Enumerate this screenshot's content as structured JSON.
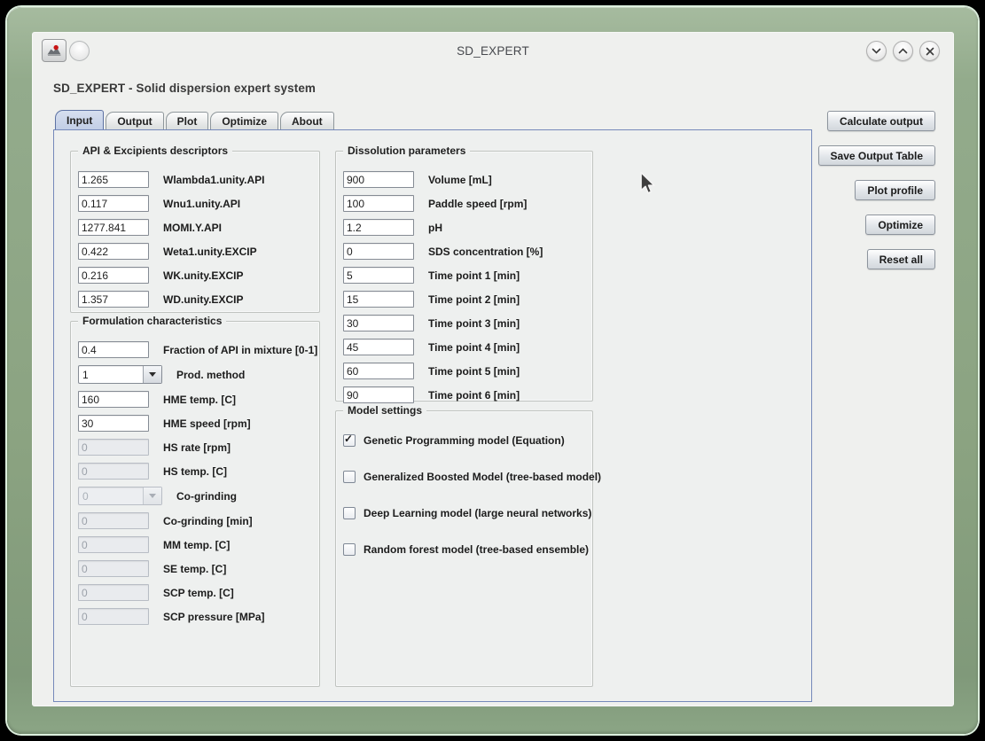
{
  "titlebar": {
    "title": "SD_EXPERT",
    "controls": [
      {
        "name": "minimize",
        "icon": "chevron-down-icon"
      },
      {
        "name": "maximize",
        "icon": "chevron-up-icon"
      },
      {
        "name": "close",
        "icon": "close-icon"
      }
    ]
  },
  "heading": "SD_EXPERT - Solid dispersion expert system",
  "tabs": [
    {
      "label": "Input",
      "selected": true
    },
    {
      "label": "Output",
      "selected": false
    },
    {
      "label": "Plot",
      "selected": false
    },
    {
      "label": "Optimize",
      "selected": false
    },
    {
      "label": "About",
      "selected": false
    }
  ],
  "groups": {
    "api": {
      "title": "API & Excipients descriptors",
      "rows": [
        {
          "value": "1.265",
          "label": "Wlambda1.unity.API",
          "type": "text",
          "enabled": true
        },
        {
          "value": "0.117",
          "label": "Wnu1.unity.API",
          "type": "text",
          "enabled": true
        },
        {
          "value": "1277.841",
          "label": "MOMI.Y.API",
          "type": "text",
          "enabled": true
        },
        {
          "value": "0.422",
          "label": "Weta1.unity.EXCIP",
          "type": "text",
          "enabled": true
        },
        {
          "value": "0.216",
          "label": "WK.unity.EXCIP",
          "type": "text",
          "enabled": true
        },
        {
          "value": "1.357",
          "label": "WD.unity.EXCIP",
          "type": "text",
          "enabled": true
        }
      ]
    },
    "formulation": {
      "title": "Formulation characteristics",
      "rows": [
        {
          "value": "0.4",
          "label": "Fraction of API in mixture [0-1]",
          "type": "text",
          "enabled": true
        },
        {
          "value": "1",
          "label": "Prod. method",
          "type": "combo",
          "enabled": true
        },
        {
          "value": "160",
          "label": "HME temp. [C]",
          "type": "text",
          "enabled": true
        },
        {
          "value": "30",
          "label": "HME speed [rpm]",
          "type": "text",
          "enabled": true
        },
        {
          "value": "0",
          "label": "HS rate [rpm]",
          "type": "text",
          "enabled": false
        },
        {
          "value": "0",
          "label": "HS temp. [C]",
          "type": "text",
          "enabled": false
        },
        {
          "value": "0",
          "label": "Co-grinding",
          "type": "combo",
          "enabled": false
        },
        {
          "value": "0",
          "label": "Co-grinding [min]",
          "type": "text",
          "enabled": false
        },
        {
          "value": "0",
          "label": "MM temp. [C]",
          "type": "text",
          "enabled": false
        },
        {
          "value": "0",
          "label": "SE temp. [C]",
          "type": "text",
          "enabled": false
        },
        {
          "value": "0",
          "label": "SCP temp. [C]",
          "type": "text",
          "enabled": false
        },
        {
          "value": "0",
          "label": "SCP pressure [MPa]",
          "type": "text",
          "enabled": false
        }
      ]
    },
    "dissolution": {
      "title": "Dissolution parameters",
      "rows": [
        {
          "value": "900",
          "label": "Volume [mL]",
          "type": "text",
          "enabled": true
        },
        {
          "value": "100",
          "label": "Paddle speed [rpm]",
          "type": "text",
          "enabled": true
        },
        {
          "value": "1.2",
          "label": "pH",
          "type": "text",
          "enabled": true
        },
        {
          "value": "0",
          "label": "SDS concentration [%]",
          "type": "text",
          "enabled": true
        },
        {
          "value": "5",
          "label": "Time point 1 [min]",
          "type": "text",
          "enabled": true
        },
        {
          "value": "15",
          "label": "Time point 2 [min]",
          "type": "text",
          "enabled": true
        },
        {
          "value": "30",
          "label": "Time point 3 [min]",
          "type": "text",
          "enabled": true
        },
        {
          "value": "45",
          "label": "Time point 4 [min]",
          "type": "text",
          "enabled": true
        },
        {
          "value": "60",
          "label": "Time point 5 [min]",
          "type": "text",
          "enabled": true
        },
        {
          "value": "90",
          "label": "Time point 6 [min]",
          "type": "text",
          "enabled": true
        }
      ]
    },
    "model": {
      "title": "Model settings",
      "checkboxes": [
        {
          "label": "Genetic Programming model (Equation)",
          "checked": true
        },
        {
          "label": "Generalized Boosted Model (tree-based model)",
          "checked": false
        },
        {
          "label": "Deep Learning model (large neural networks)",
          "checked": false
        },
        {
          "label": "Random forest model (tree-based ensemble)",
          "checked": false
        }
      ]
    }
  },
  "action_buttons": [
    "Calculate output",
    "Save Output Table",
    "Plot profile",
    "Optimize",
    "Reset all"
  ],
  "colors": {
    "frame_green": "#8ba381",
    "selected_tab": "#c8d3e8",
    "panel_border": "#7589ba",
    "checkbox_accent": "#1c1c1c",
    "app_icon_red": "#c81414"
  }
}
